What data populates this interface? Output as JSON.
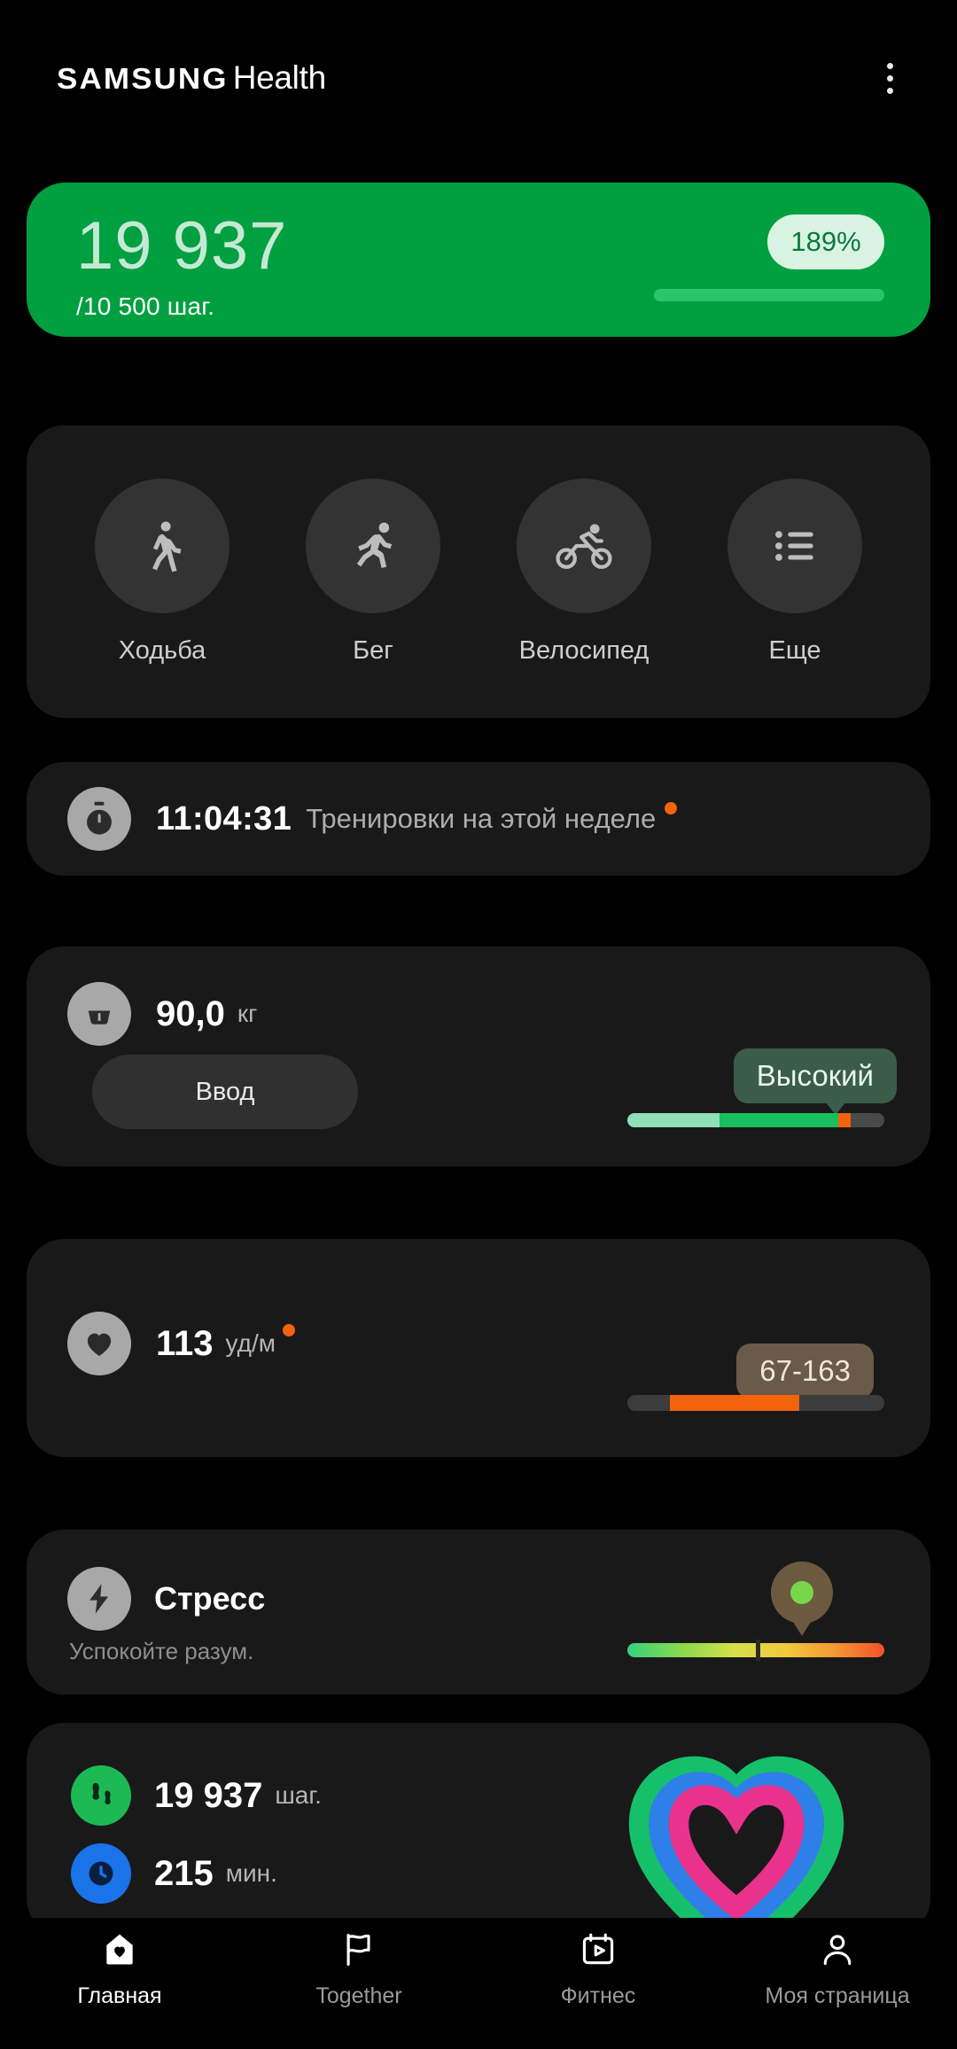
{
  "header": {
    "brand_samsung": "SAMSUNG",
    "brand_health": "Health",
    "menu_icon": "kebab-menu-icon"
  },
  "steps_card": {
    "value": "19 937",
    "goal": "/10 500 шаг.",
    "percent": "189%",
    "bg_color": "#00a040",
    "value_color": "#c5e9d4",
    "badge_bg": "#d8f3e2",
    "badge_text_color": "#0b7a3c",
    "progress_color": "#2cc46b"
  },
  "activities": {
    "items": [
      {
        "label": "Ходьба",
        "icon": "walking-icon"
      },
      {
        "label": "Бег",
        "icon": "running-icon"
      },
      {
        "label": "Велосипед",
        "icon": "cycling-icon"
      },
      {
        "label": "Еще",
        "icon": "list-more-icon"
      }
    ]
  },
  "workout_card": {
    "time": "11:04:31",
    "subtitle": "Тренировки на этой неделе",
    "icon": "stopwatch-icon",
    "badge_color": "#f2630c"
  },
  "weight_card": {
    "value": "90,0",
    "unit": "кг",
    "input_label": "Ввод",
    "status": "Высокий",
    "icon": "scale-icon",
    "status_bg": "#3a5c49",
    "segments": [
      {
        "color": "#8fe0b4",
        "width": 36
      },
      {
        "color": "#19bf5f",
        "width": 46
      },
      {
        "color": "#f2630c",
        "width": 5
      },
      {
        "color": "#4a4a4a",
        "width": 13
      }
    ]
  },
  "heart_card": {
    "value": "113",
    "unit": "уд/м",
    "range": "67-163",
    "icon": "heart-icon",
    "range_bg": "#6a5a48",
    "bar_color": "#f2630c",
    "badge_color": "#f2630c"
  },
  "stress_card": {
    "title": "Стресс",
    "subtitle": "Успокойте разум.",
    "icon": "lightning-icon",
    "knob_color": "#6b5a3f",
    "knob_dot_color": "#78d64b"
  },
  "summary_card": {
    "rows": [
      {
        "value": "19 937",
        "unit": "шаг.",
        "icon": "steps-icon",
        "color": "#1db954"
      },
      {
        "value": "215",
        "unit": "мин.",
        "icon": "clock-icon",
        "color": "#1a73e8"
      }
    ],
    "rings": {
      "colors": [
        "#16c06a",
        "#2f7fe8",
        "#e8328c"
      ]
    }
  },
  "bottom_nav": {
    "items": [
      {
        "label": "Главная",
        "icon": "home-heart-icon",
        "active": true
      },
      {
        "label": "Together",
        "icon": "flag-icon",
        "active": false
      },
      {
        "label": "Фитнес",
        "icon": "calendar-play-icon",
        "active": false
      },
      {
        "label": "Моя страница",
        "icon": "person-icon",
        "active": false
      }
    ]
  }
}
